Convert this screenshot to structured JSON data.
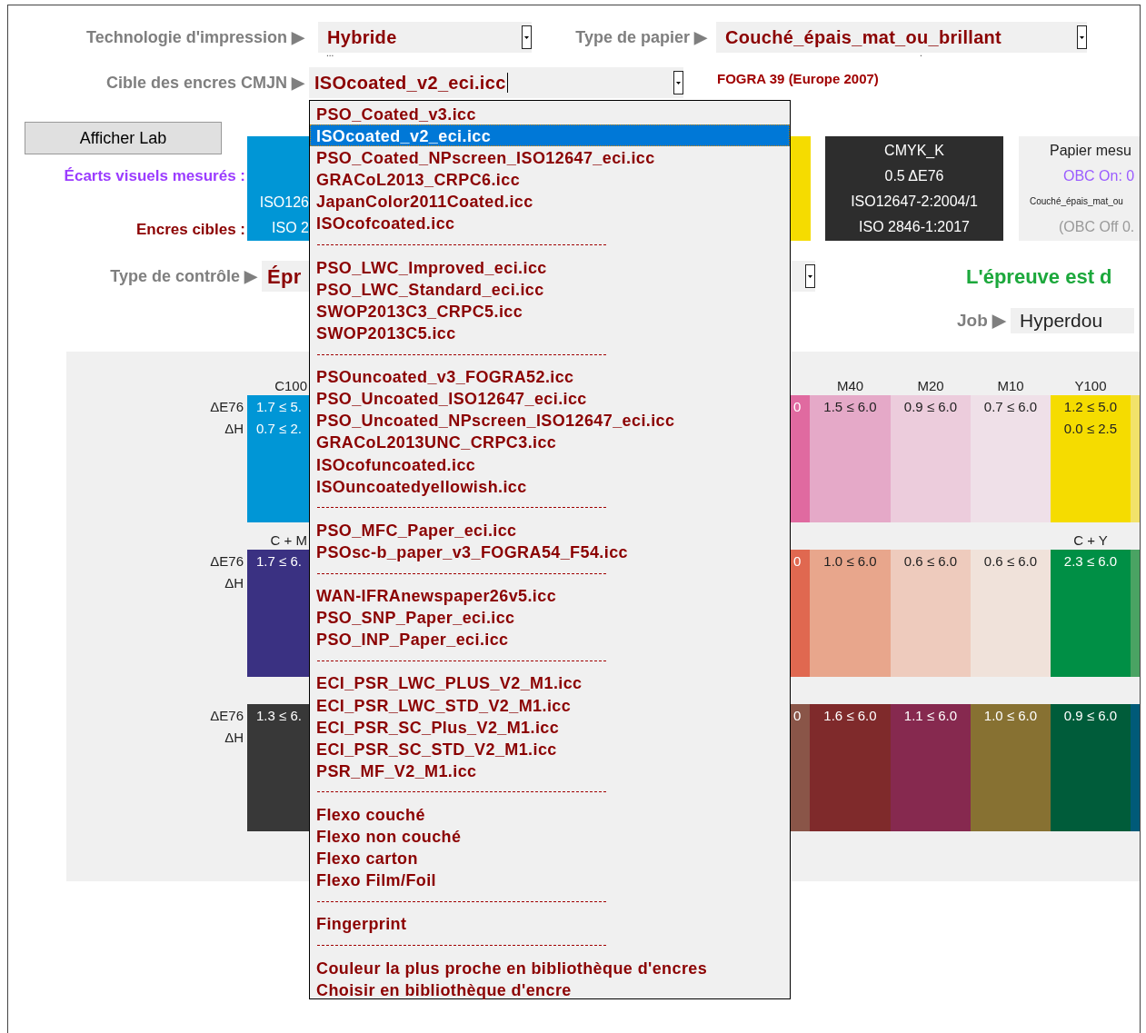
{
  "print_tech": {
    "label": "Technologie d'impression ▶",
    "value": "Hybride"
  },
  "paper_type": {
    "label": "Type de papier ▶",
    "value": "Couché_épais_mat_ou_brillant"
  },
  "marks": [
    "...",
    "."
  ],
  "ink_target": {
    "label": "Cible des encres CMJN ▶",
    "value": "ISOcoated_v2_eci.icc",
    "note": "FOGRA 39 (Europe 2007)",
    "expanded": true,
    "options": [
      {
        "kind": "item",
        "text": "PSO_Coated_v3.icc",
        "selected": false
      },
      {
        "kind": "item",
        "text": "ISOcoated_v2_eci.icc",
        "selected": true
      },
      {
        "kind": "item",
        "text": "PSO_Coated_NPscreen_ISO12647_eci.icc",
        "selected": false
      },
      {
        "kind": "item",
        "text": "GRACoL2013_CRPC6.icc",
        "selected": false
      },
      {
        "kind": "item",
        "text": "JapanColor2011Coated.icc",
        "selected": false
      },
      {
        "kind": "item",
        "text": "ISOcofcoated.icc",
        "selected": false
      },
      {
        "kind": "divider"
      },
      {
        "kind": "item",
        "text": "PSO_LWC_Improved_eci.icc",
        "selected": false
      },
      {
        "kind": "item",
        "text": "PSO_LWC_Standard_eci.icc",
        "selected": false
      },
      {
        "kind": "item",
        "text": "SWOP2013C3_CRPC5.icc",
        "selected": false
      },
      {
        "kind": "item",
        "text": "SWOP2013C5.icc",
        "selected": false
      },
      {
        "kind": "divider"
      },
      {
        "kind": "item",
        "text": "PSOuncoated_v3_FOGRA52.icc",
        "selected": false
      },
      {
        "kind": "item",
        "text": "PSO_Uncoated_ISO12647_eci.icc",
        "selected": false
      },
      {
        "kind": "item",
        "text": "PSO_Uncoated_NPscreen_ISO12647_eci.icc",
        "selected": false
      },
      {
        "kind": "item",
        "text": "GRACoL2013UNC_CRPC3.icc",
        "selected": false
      },
      {
        "kind": "item",
        "text": "ISOcofuncoated.icc",
        "selected": false
      },
      {
        "kind": "item",
        "text": "ISOuncoatedyellowish.icc",
        "selected": false
      },
      {
        "kind": "divider"
      },
      {
        "kind": "item",
        "text": "PSO_MFC_Paper_eci.icc",
        "selected": false
      },
      {
        "kind": "item",
        "text": "PSOsc-b_paper_v3_FOGRA54_F54.icc",
        "selected": false
      },
      {
        "kind": "divider"
      },
      {
        "kind": "item",
        "text": "WAN-IFRAnewspaper26v5.icc",
        "selected": false
      },
      {
        "kind": "item",
        "text": "PSO_SNP_Paper_eci.icc",
        "selected": false
      },
      {
        "kind": "item",
        "text": "PSO_INP_Paper_eci.icc",
        "selected": false
      },
      {
        "kind": "divider"
      },
      {
        "kind": "item",
        "text": "ECI_PSR_LWC_PLUS_V2_M1.icc",
        "selected": false
      },
      {
        "kind": "item",
        "text": "ECI_PSR_LWC_STD_V2_M1.icc",
        "selected": false
      },
      {
        "kind": "item",
        "text": "ECI_PSR_SC_Plus_V2_M1.icc",
        "selected": false
      },
      {
        "kind": "item",
        "text": "ECI_PSR_SC_STD_V2_M1.icc",
        "selected": false
      },
      {
        "kind": "item",
        "text": "PSR_MF_V2_M1.icc",
        "selected": false
      },
      {
        "kind": "divider"
      },
      {
        "kind": "item",
        "text": "Flexo couché",
        "selected": false
      },
      {
        "kind": "item",
        "text": "Flexo non couché",
        "selected": false
      },
      {
        "kind": "item",
        "text": "Flexo carton",
        "selected": false
      },
      {
        "kind": "item",
        "text": "Flexo Film/Foil",
        "selected": false
      },
      {
        "kind": "divider"
      },
      {
        "kind": "item",
        "text": "Fingerprint",
        "selected": false
      },
      {
        "kind": "divider"
      },
      {
        "kind": "item",
        "text": "Couleur la plus proche en bibliothèque d'encres",
        "selected": false
      },
      {
        "kind": "item",
        "text": "Choisir en bibliothèque d'encre",
        "selected": false
      }
    ]
  },
  "lab_button": "Afficher Lab",
  "row_labels": {
    "measured": "Écarts visuels mesurés :",
    "target": "Encres cibles :"
  },
  "swatches": [
    {
      "kind": "partial",
      "color": "#0096d6",
      "lines": [
        "ISO126",
        "ISO 2"
      ]
    },
    {
      "kind": "edge",
      "color": "#f5dc00"
    },
    {
      "kind": "full",
      "color": "#2d2d2d",
      "lines": [
        "CMYK_K",
        "0.5 ΔE76",
        "ISO12647-2:2004/1",
        "ISO 2846-1:2017"
      ]
    }
  ],
  "paper_panel": [
    {
      "kind": "title",
      "text": "Papier mesu"
    },
    {
      "kind": "obc_on",
      "text": "OBC On: 0"
    },
    {
      "kind": "paper",
      "text": "Couché_épais_mat_ou"
    },
    {
      "kind": "obc_off",
      "text": "(OBC Off 0."
    }
  ],
  "control": {
    "label": "Type de contrôle ▶",
    "value": "Épr",
    "status": "L'épreuve est d"
  },
  "job": {
    "label": "Job ▶",
    "value": "Hyperdou"
  },
  "grid": [
    {
      "labels": [
        "ΔE76",
        "ΔH"
      ],
      "left": {
        "header": "C100",
        "color": "#0096d6",
        "lines": [
          "1.7 ≤ 5.",
          "0.7 ≤ 2."
        ]
      },
      "right": [
        {
          "color": "#e06aa0",
          "lines": [
            "0"
          ]
        },
        {
          "header": "M40",
          "color": "#e5a9c8",
          "lines": [
            "1.5 ≤ 6.0"
          ]
        },
        {
          "header": "M20",
          "color": "#ecccdc",
          "lines": [
            "0.9 ≤ 6.0"
          ]
        },
        {
          "header": "M10",
          "color": "#efe0e8",
          "lines": [
            "0.7 ≤ 6.0"
          ]
        },
        {
          "header": "Y100",
          "color": "#f5dc00",
          "lines": [
            "1.2 ≤ 5.0",
            "0.0 ≤ 2.5"
          ]
        },
        {
          "color": "#f2e26a"
        }
      ]
    },
    {
      "labels": [
        "ΔE76",
        "ΔH"
      ],
      "left": {
        "header": "C + M",
        "color": "#3a3182",
        "lines": [
          "1.7 ≤ 6."
        ]
      },
      "right": [
        {
          "color": "#e06850",
          "lines": [
            "0"
          ]
        },
        {
          "color": "#e8a68c",
          "lines": [
            "1.0 ≤ 6.0"
          ]
        },
        {
          "color": "#eecbbd",
          "lines": [
            "0.6 ≤ 6.0"
          ]
        },
        {
          "color": "#f0e2da",
          "lines": [
            "0.6 ≤ 6.0"
          ]
        },
        {
          "header": "C + Y",
          "color": "#008f45",
          "lines": [
            "2.3 ≤ 6.0"
          ]
        },
        {
          "color": "#4aa363"
        }
      ]
    },
    {
      "labels": [
        "ΔE76",
        "ΔH"
      ],
      "left": {
        "color": "#383838",
        "lines": [
          "1.3 ≤ 6."
        ]
      },
      "right": [
        {
          "color": "#8a5548",
          "lines": [
            "0"
          ]
        },
        {
          "color": "#7f2a2b",
          "lines": [
            "1.6 ≤ 6.0"
          ]
        },
        {
          "color": "#86294f",
          "lines": [
            "1.1 ≤ 6.0"
          ]
        },
        {
          "color": "#877132",
          "lines": [
            "1.0 ≤ 6.0"
          ]
        },
        {
          "color": "#005c3a",
          "lines": [
            "0.9 ≤ 6.0"
          ]
        },
        {
          "color": "#005a78"
        }
      ]
    }
  ]
}
